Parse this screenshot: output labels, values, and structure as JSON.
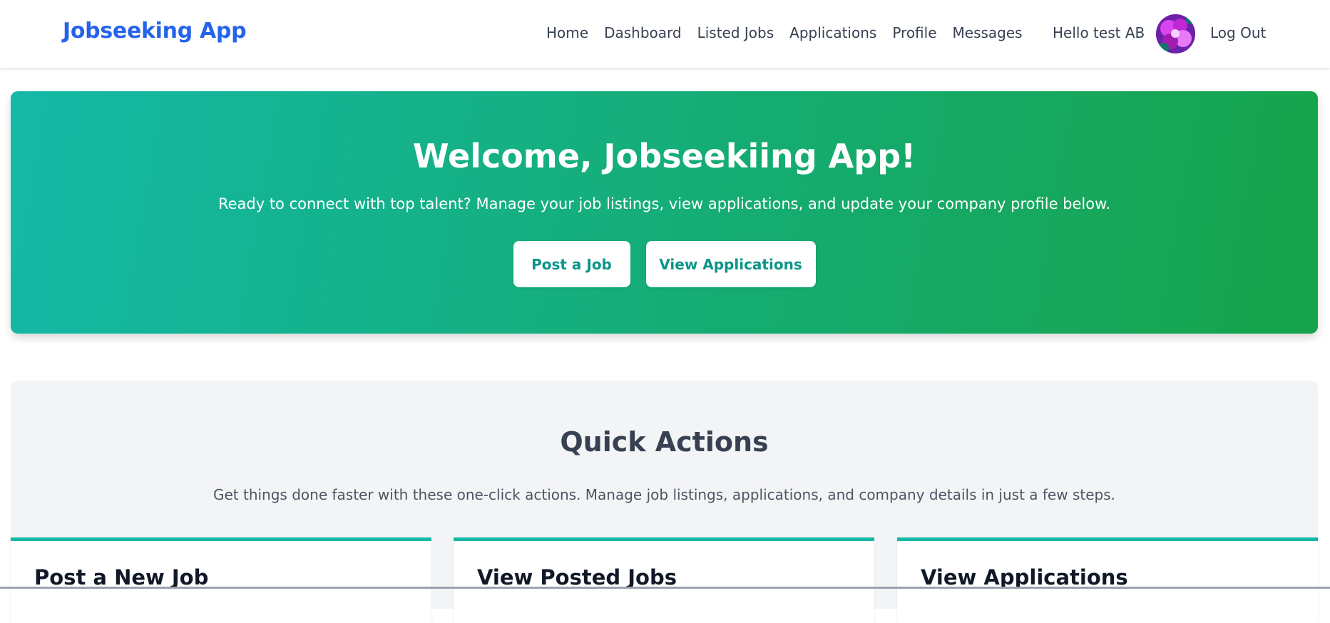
{
  "navbar": {
    "brand": "Jobseeking App",
    "links": [
      {
        "label": "Home"
      },
      {
        "label": "Dashboard"
      },
      {
        "label": "Listed Jobs"
      },
      {
        "label": "Applications"
      },
      {
        "label": "Profile"
      },
      {
        "label": "Messages"
      }
    ],
    "greeting": "Hello test AB",
    "logout_label": "Log Out"
  },
  "hero": {
    "title": "Welcome, Jobseekiing App!",
    "subtitle": "Ready to connect with top talent? Manage your job listings, view applications, and update your company profile below.",
    "post_job_label": "Post a Job",
    "view_applications_label": "View Applications"
  },
  "quick_actions": {
    "title": "Quick Actions",
    "subtitle": "Get things done faster with these one-click actions. Manage job listings, applications, and company details in just a few steps.",
    "cards": [
      {
        "title": "Post a New Job"
      },
      {
        "title": "View Posted Jobs"
      },
      {
        "title": "View Applications"
      }
    ]
  },
  "colors": {
    "brand": "#2563eb",
    "hero_gradient_start": "#14b8a6",
    "hero_gradient_end": "#16a34a",
    "button_text": "#0d9488",
    "card_accent": "#14b8a6"
  }
}
